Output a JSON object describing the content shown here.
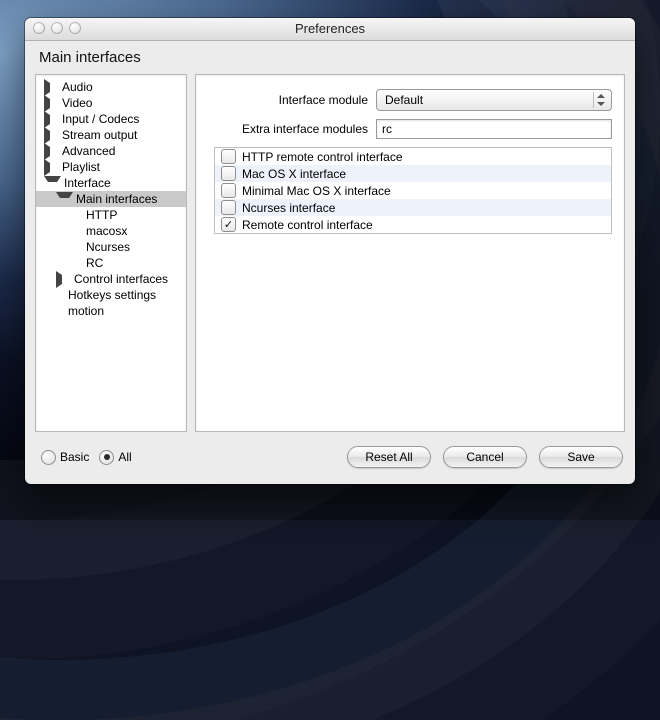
{
  "window": {
    "title": "Preferences",
    "section_title": "Main interfaces"
  },
  "sidebar": {
    "items": [
      {
        "label": "Audio",
        "indent": 0,
        "arrow": "right",
        "selected": false
      },
      {
        "label": "Video",
        "indent": 0,
        "arrow": "right",
        "selected": false
      },
      {
        "label": "Input / Codecs",
        "indent": 0,
        "arrow": "right",
        "selected": false
      },
      {
        "label": "Stream output",
        "indent": 0,
        "arrow": "right",
        "selected": false
      },
      {
        "label": "Advanced",
        "indent": 0,
        "arrow": "right",
        "selected": false
      },
      {
        "label": "Playlist",
        "indent": 0,
        "arrow": "right",
        "selected": false
      },
      {
        "label": "Interface",
        "indent": 0,
        "arrow": "down",
        "selected": false
      },
      {
        "label": "Main interfaces",
        "indent": 1,
        "arrow": "down",
        "selected": true
      },
      {
        "label": "HTTP",
        "indent": 2,
        "arrow": "",
        "selected": false
      },
      {
        "label": "macosx",
        "indent": 2,
        "arrow": "",
        "selected": false
      },
      {
        "label": "Ncurses",
        "indent": 2,
        "arrow": "",
        "selected": false
      },
      {
        "label": "RC",
        "indent": 2,
        "arrow": "",
        "selected": false
      },
      {
        "label": "Control interfaces",
        "indent": 1,
        "arrow": "right",
        "selected": false
      },
      {
        "label": "Hotkeys settings",
        "indent": 1,
        "arrow": "",
        "selected": false
      },
      {
        "label": "motion",
        "indent": 1,
        "arrow": "",
        "selected": false
      }
    ]
  },
  "form": {
    "interface_module_label": "Interface module",
    "interface_module_value": "Default",
    "extra_modules_label": "Extra interface modules",
    "extra_modules_value": "rc"
  },
  "checklist": [
    {
      "label": "HTTP remote control interface",
      "checked": false,
      "alt": false
    },
    {
      "label": "Mac OS X interface",
      "checked": false,
      "alt": true
    },
    {
      "label": "Minimal Mac OS X interface",
      "checked": false,
      "alt": false
    },
    {
      "label": "Ncurses interface",
      "checked": false,
      "alt": true
    },
    {
      "label": "Remote control interface",
      "checked": true,
      "alt": false
    }
  ],
  "footer": {
    "basic_label": "Basic",
    "all_label": "All",
    "mode": "all",
    "reset_label": "Reset All",
    "cancel_label": "Cancel",
    "save_label": "Save"
  }
}
